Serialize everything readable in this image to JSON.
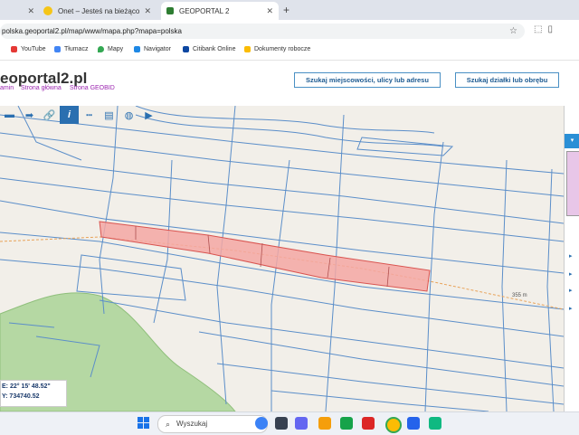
{
  "browser": {
    "tabs": [
      {
        "title": "",
        "active": false
      },
      {
        "title": "Onet – Jesteś na bieżąco",
        "active": false
      },
      {
        "title": "GEOPORTAL 2",
        "active": true
      }
    ],
    "new_tab": "+",
    "address": "polska.geoportal2.pl/map/www/mapa.php?mapa=polska",
    "bookmarks": [
      "YouTube",
      "Tłumacz",
      "Mapy",
      "Navigator",
      "Citibank Online",
      "Dokumenty robocze"
    ]
  },
  "header": {
    "logo": "eoportal2.pl",
    "links": [
      "amin",
      "Strona główna",
      "Strona GEOBID"
    ],
    "search_location_button": "Szukaj miejscowości, ulicy lub adresu",
    "search_parcel_button": "Szukaj działki lub obrębu"
  },
  "toolbar": {
    "tools": [
      "move-icon",
      "arrow-right-icon",
      "link-icon",
      "info-icon",
      "measure-icon",
      "print-icon",
      "globe-icon",
      "video-icon"
    ],
    "active_tool": "info-icon"
  },
  "map": {
    "scale_label": "355 m",
    "parcel_highlight_color": "#f4a7a3",
    "forest_color": "#b5d8a3"
  },
  "coordinates": {
    "lon": "E:  22° 15' 48.52\"",
    "lat": "Y:  734740.52"
  },
  "taskbar": {
    "search_placeholder": "Wyszukaj"
  }
}
